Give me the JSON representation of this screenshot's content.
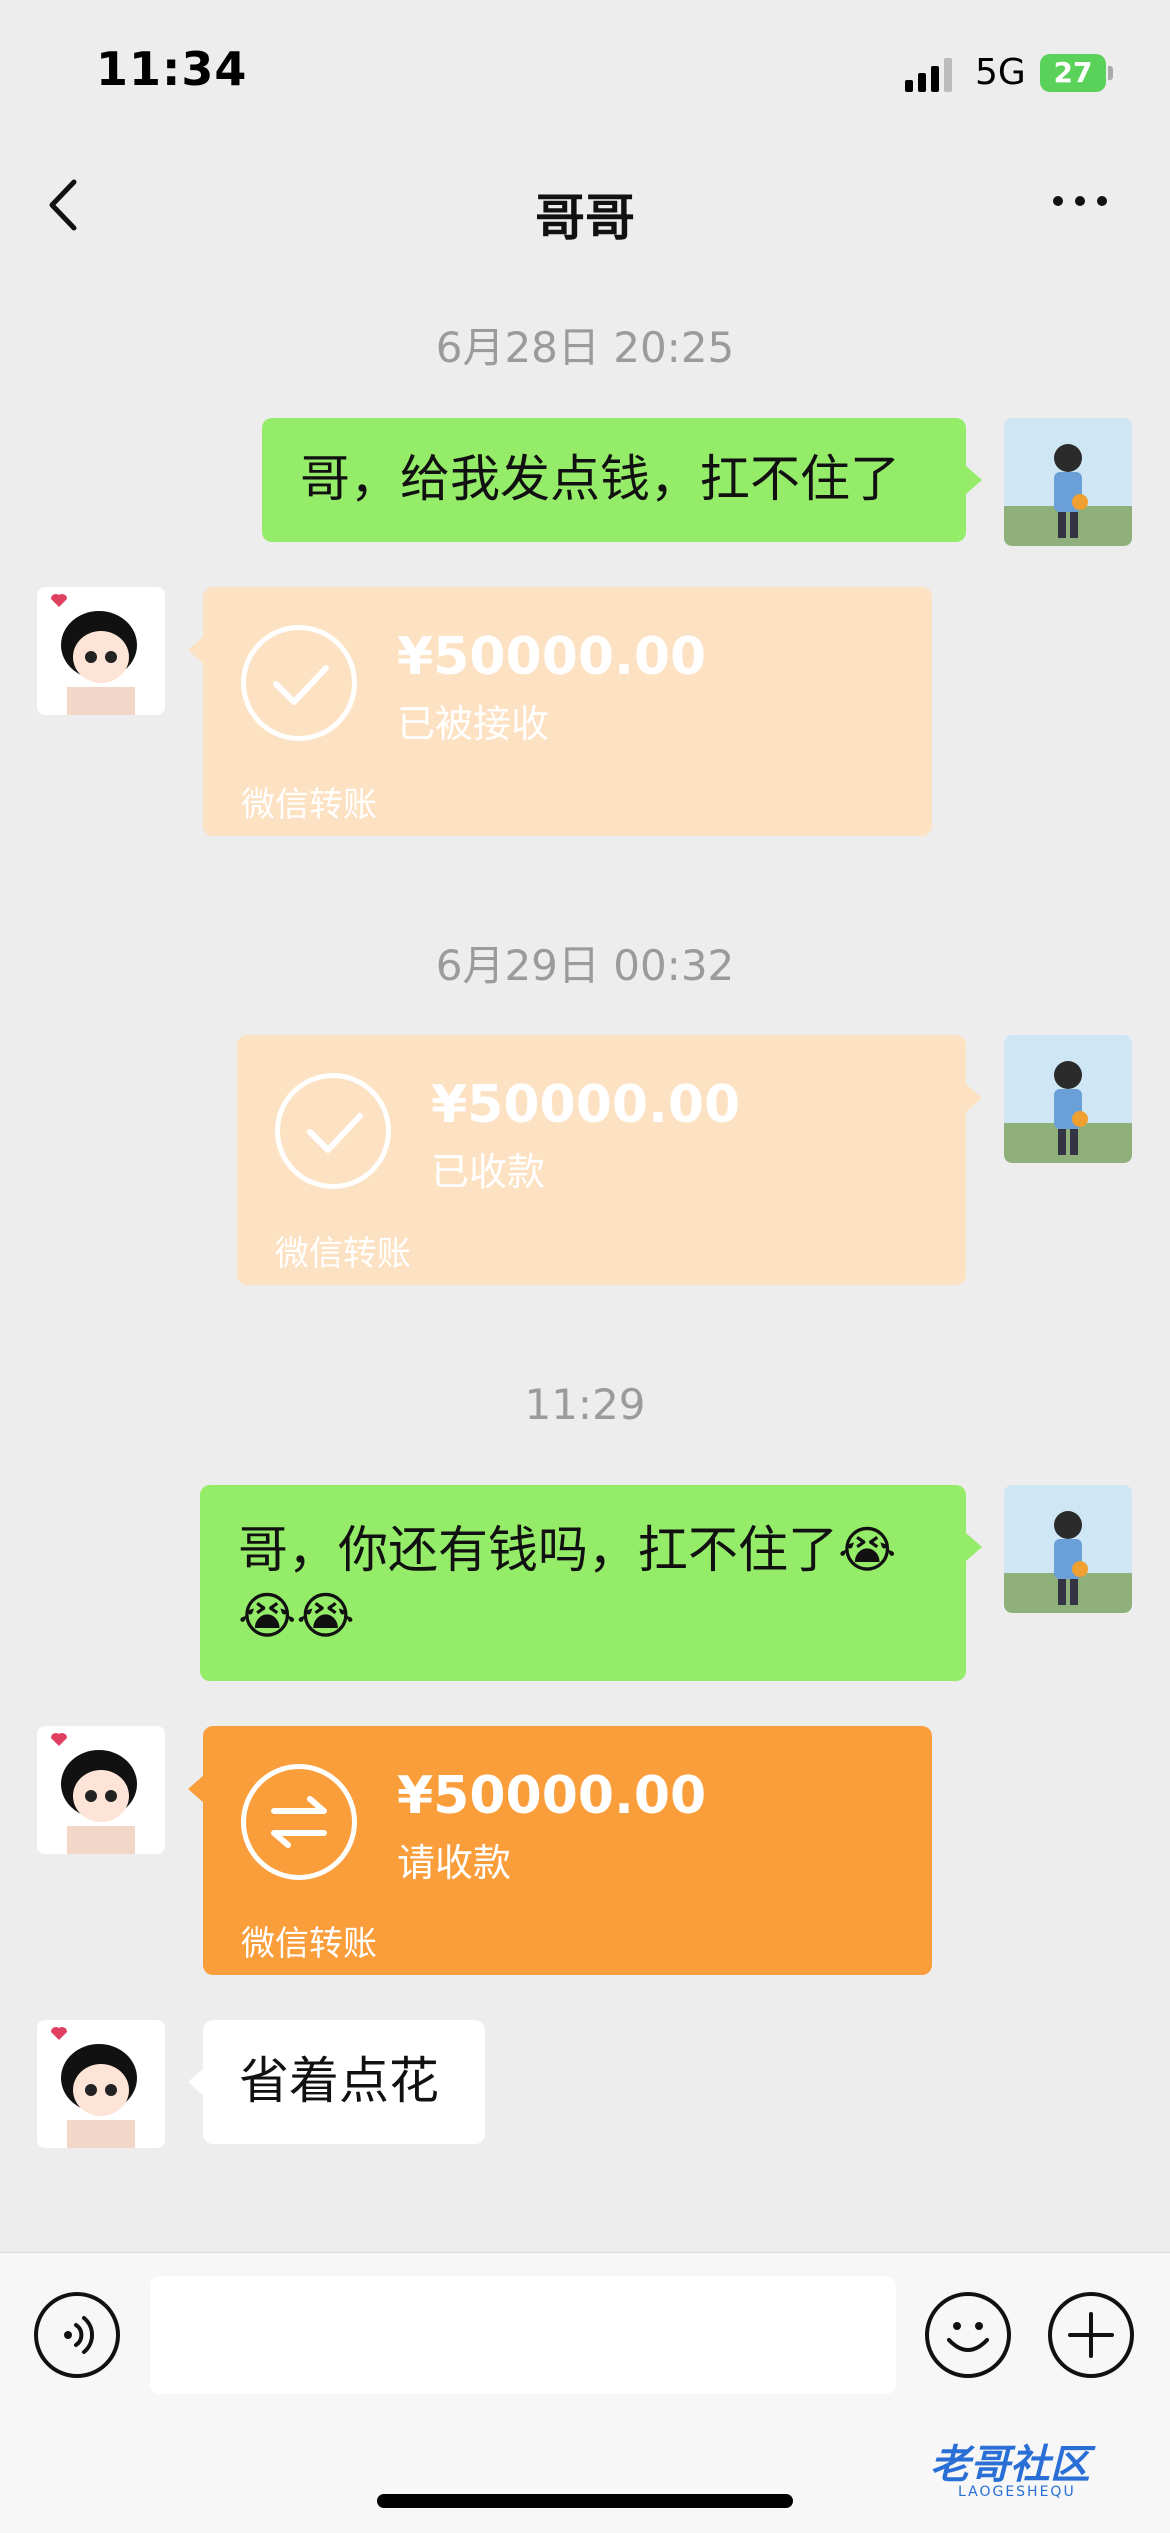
{
  "status_bar": {
    "time": "11:34",
    "network": "5G",
    "battery": "27"
  },
  "nav": {
    "title": "哥哥"
  },
  "messages": {
    "ts1": "6月28日 20:25",
    "msg1": "哥，给我发点钱，扛不住了",
    "card1": {
      "amount": "¥50000.00",
      "status": "已被接收",
      "footer": "微信转账"
    },
    "ts2": "6月29日 00:32",
    "card2": {
      "amount": "¥50000.00",
      "status": "已收款",
      "footer": "微信转账"
    },
    "ts3": "11:29",
    "msg2": "哥，你还有钱吗，扛不住了😭😭😭",
    "card3": {
      "amount": "¥50000.00",
      "status": "请收款",
      "footer": "微信转账"
    },
    "msg3": "省着点花"
  },
  "watermark": {
    "text": "老哥社区",
    "sub": "LAOGESHEQU"
  },
  "colors": {
    "green_bubble": "#95ec69",
    "pale_card": "#fde1c3",
    "orange_card": "#fa9d3b",
    "background": "#ededed"
  }
}
